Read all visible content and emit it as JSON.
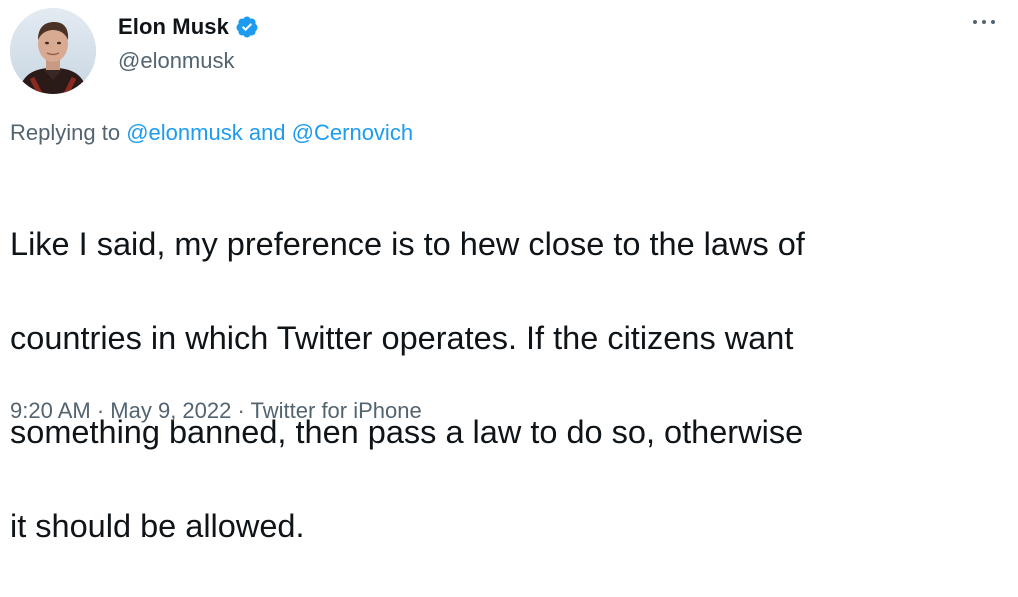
{
  "author": {
    "display_name": "Elon Musk",
    "handle": "@elonmusk",
    "verified": true,
    "avatar_icon": "profile-photo",
    "verified_icon": "verified-badge-icon"
  },
  "more_icon": "more-options-icon",
  "reply_context": {
    "prefix": "Replying to",
    "mention_1": "@elonmusk",
    "conjunction": "and",
    "mention_2": "@Cernovich"
  },
  "body": {
    "line_1": "Like I said, my preference is to hew close to the laws of",
    "line_2": "countries in which Twitter operates. If the citizens want",
    "line_3": "something banned, then pass a law to do so, otherwise",
    "line_4": "it should be allowed."
  },
  "meta": {
    "time": "9:20 AM",
    "separator": "·",
    "date": "May 9, 2022",
    "source": "Twitter for iPhone"
  },
  "colors": {
    "text": "#0f1419",
    "secondary": "#536471",
    "link": "#1d9bf0",
    "verified": "#1d9bf0"
  }
}
